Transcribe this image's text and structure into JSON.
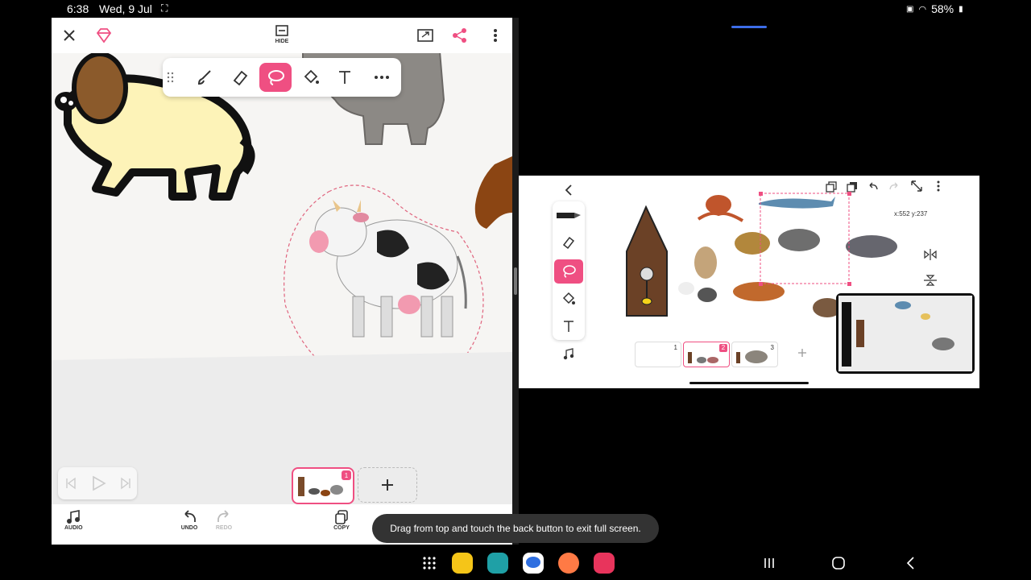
{
  "status_bar": {
    "time": "6:38",
    "date": "Wed, 9 Jul",
    "battery": "58%"
  },
  "left_app": {
    "hide_label": "HIDE",
    "bottom": {
      "audio_label": "AUDIO",
      "undo_label": "UNDO",
      "redo_label": "REDO",
      "copy_label": "COPY"
    },
    "frame_badge": "1"
  },
  "right_app": {
    "coordinate_readout": "x:552 y:237",
    "frames": [
      {
        "number": "1"
      },
      {
        "number": "2"
      },
      {
        "number": "3"
      }
    ]
  },
  "toast": {
    "text": "Drag from top and touch the back button to exit full screen."
  },
  "colors": {
    "accent": "#ef4f82",
    "pill": "#3d6de8"
  }
}
